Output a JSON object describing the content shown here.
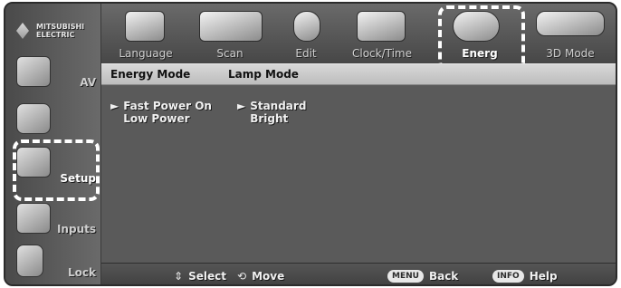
{
  "brand": {
    "logo_text": "MITSUBISHI\nELECTRIC"
  },
  "tabs": [
    {
      "label": "Language",
      "icon": "language-icon",
      "active": false
    },
    {
      "label": "Scan",
      "icon": "scan-icon",
      "active": false
    },
    {
      "label": "Edit",
      "icon": "edit-icon",
      "active": false
    },
    {
      "label": "Clock/Time",
      "icon": "clock-icon",
      "active": false
    },
    {
      "label": "Energ",
      "icon": "energy-icon",
      "active": true
    },
    {
      "label": "3D Mode",
      "icon": "3d-glasses-icon",
      "active": false
    }
  ],
  "sidebar": {
    "items": [
      {
        "label": "AV",
        "icon": "av-icon",
        "active": false
      },
      {
        "label": "",
        "icon": "closed-caption-icon",
        "active": false
      },
      {
        "label": "Setup",
        "icon": "setup-icon",
        "active": true
      },
      {
        "label": "Inputs",
        "icon": "inputs-icon",
        "active": false
      },
      {
        "label": "Lock",
        "icon": "lock-icon",
        "active": false
      }
    ]
  },
  "table": {
    "headers": [
      "Energy Mode",
      "Lamp Mode"
    ],
    "columns": [
      [
        "Fast Power On",
        "Low Power"
      ],
      [
        "Standard",
        "Bright"
      ]
    ],
    "selected_markers": {
      "col0_row0": "►",
      "col1_row0": "►"
    }
  },
  "help": {
    "select_label": "Select",
    "move_label": "Move",
    "back_label": "Back",
    "help_label": "Help",
    "menu_key": "MENU",
    "info_key": "INFO",
    "select_icon": "⇕",
    "move_icon": "⟲"
  },
  "colors": {
    "frame_bg": "#5a5a5a",
    "header_bg": "#c9c9c9",
    "text_light": "#f0f0f0",
    "active_highlight": "#ffffff"
  }
}
